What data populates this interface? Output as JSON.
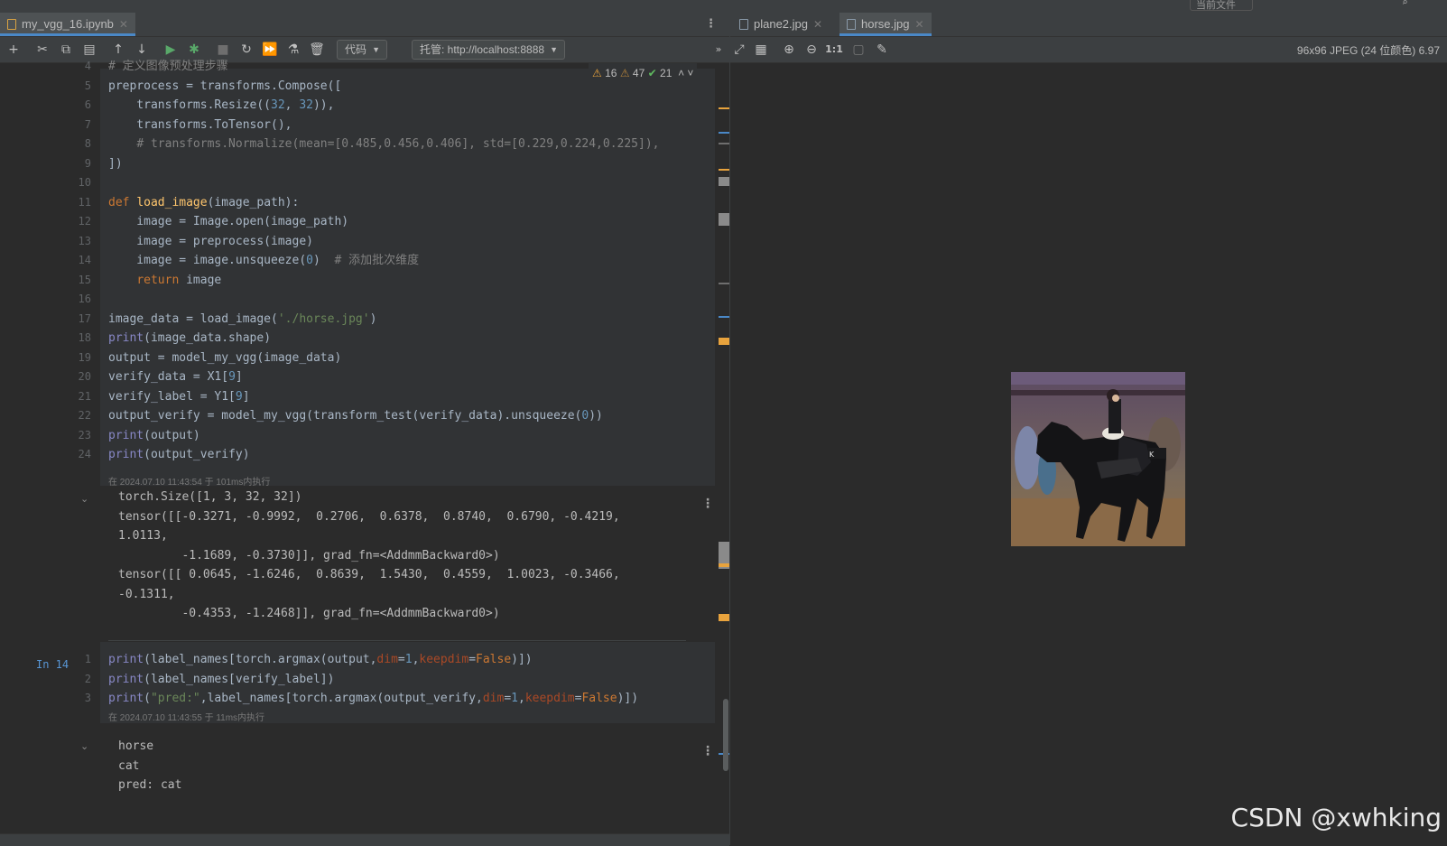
{
  "top_strip": {
    "scope_dropdown": "当前文件"
  },
  "left_tabs": [
    {
      "label": "my_vgg_16.ipynb",
      "active": true
    }
  ],
  "toolbar": {
    "cell_type": "代码",
    "kernel": "托管: http://localhost:8888",
    "icons": [
      "add-icon",
      "cut-icon",
      "copy-icon",
      "paste-icon",
      "move-up-icon",
      "move-down-icon",
      "run-cell-icon",
      "debug-icon",
      "stop-icon",
      "restart-icon",
      "run-all-icon",
      "clear-icon",
      "delete-icon"
    ]
  },
  "inspections": {
    "warnings": "16",
    "weak_warnings": "47",
    "ok": "21"
  },
  "cell1": {
    "lines": [
      {
        "n": "4",
        "text": "# 定义图像预处理步骤"
      },
      {
        "n": "5",
        "text": "preprocess = transforms.Compose(["
      },
      {
        "n": "6",
        "text": "    transforms.Resize((32, 32)),"
      },
      {
        "n": "7",
        "text": "    transforms.ToTensor(),"
      },
      {
        "n": "8",
        "text": "    # transforms.Normalize(mean=[0.485,0.456,0.406], std=[0.229,0.224,0.225]),"
      },
      {
        "n": "9",
        "text": "])"
      },
      {
        "n": "10",
        "text": ""
      },
      {
        "n": "11",
        "text": "def load_image(image_path):"
      },
      {
        "n": "12",
        "text": "    image = Image.open(image_path)"
      },
      {
        "n": "13",
        "text": "    image = preprocess(image)"
      },
      {
        "n": "14",
        "text": "    image = image.unsqueeze(0)  # 添加批次维度"
      },
      {
        "n": "15",
        "text": "    return image"
      },
      {
        "n": "16",
        "text": ""
      },
      {
        "n": "17",
        "text": "image_data = load_image('./horse.jpg')"
      },
      {
        "n": "18",
        "text": "print(image_data.shape)"
      },
      {
        "n": "19",
        "text": "output = model_my_vgg(image_data)"
      },
      {
        "n": "20",
        "text": "verify_data = X1[9]"
      },
      {
        "n": "21",
        "text": "verify_label = Y1[9]"
      },
      {
        "n": "22",
        "text": "output_verify = model_my_vgg(transform_test(verify_data).unsqueeze(0))"
      },
      {
        "n": "23",
        "text": "print(output)"
      },
      {
        "n": "24",
        "text": "print(output_verify)"
      }
    ],
    "exec_info": "在 2024.07.10 11:43:54 于 101ms内执行",
    "output": [
      "torch.Size([1, 3, 32, 32])",
      "tensor([[-0.3271, -0.9992,  0.2706,  0.6378,  0.8740,  0.6790, -0.4219,",
      "1.0113,",
      "         -1.1689, -0.3730]], grad_fn=<AddmmBackward0>)",
      "tensor([[ 0.0645, -1.6246,  0.8639,  1.5430,  0.4559,  1.0023, -0.3466,",
      "-0.1311,",
      "         -0.4353, -1.2468]], grad_fn=<AddmmBackward0>)"
    ]
  },
  "cell2": {
    "prompt": "In 14",
    "lines": [
      {
        "n": "1",
        "text": "print(label_names[torch.argmax(output,dim=1,keepdim=False)])"
      },
      {
        "n": "2",
        "text": "print(label_names[verify_label])"
      },
      {
        "n": "3",
        "text": "print(\"pred:\",label_names[torch.argmax(output_verify,dim=1,keepdim=False)])"
      }
    ],
    "exec_info": "在 2024.07.10 11:43:55 于 11ms内执行",
    "output": [
      "horse",
      "cat",
      "pred: cat"
    ]
  },
  "right_tabs": [
    {
      "label": "plane2.jpg",
      "active": false
    },
    {
      "label": "horse.jpg",
      "active": true
    }
  ],
  "image_info": "96x96 JPEG (24 位颜色) 6.97",
  "image_toolbar": {
    "actual_size": "1:1"
  },
  "watermark": "CSDN @xwhking"
}
